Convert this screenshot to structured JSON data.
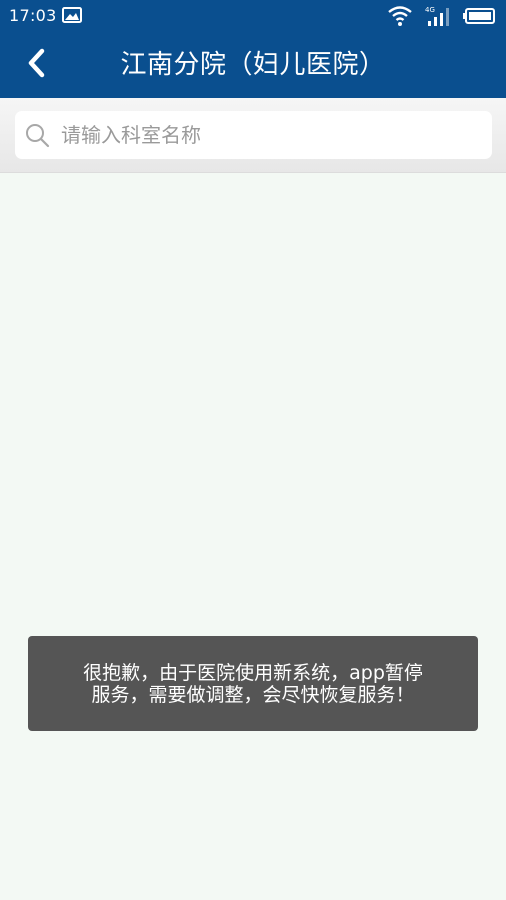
{
  "status_bar": {
    "time": "17:03",
    "network": "4G"
  },
  "header": {
    "title": "江南分院（妇儿医院）",
    "color": "#0a4f8f"
  },
  "search": {
    "placeholder": "请输入科室名称",
    "value": ""
  },
  "toast": {
    "message": "很抱歉，由于医院使用新系统，app暂停服务，需要做调整，会尽快恢复服务！"
  },
  "icons": {
    "back": "chevron-left-icon",
    "search": "search-icon",
    "notification": "image-notification-icon",
    "wifi": "wifi-icon",
    "signal": "signal-icon",
    "battery": "battery-icon"
  }
}
